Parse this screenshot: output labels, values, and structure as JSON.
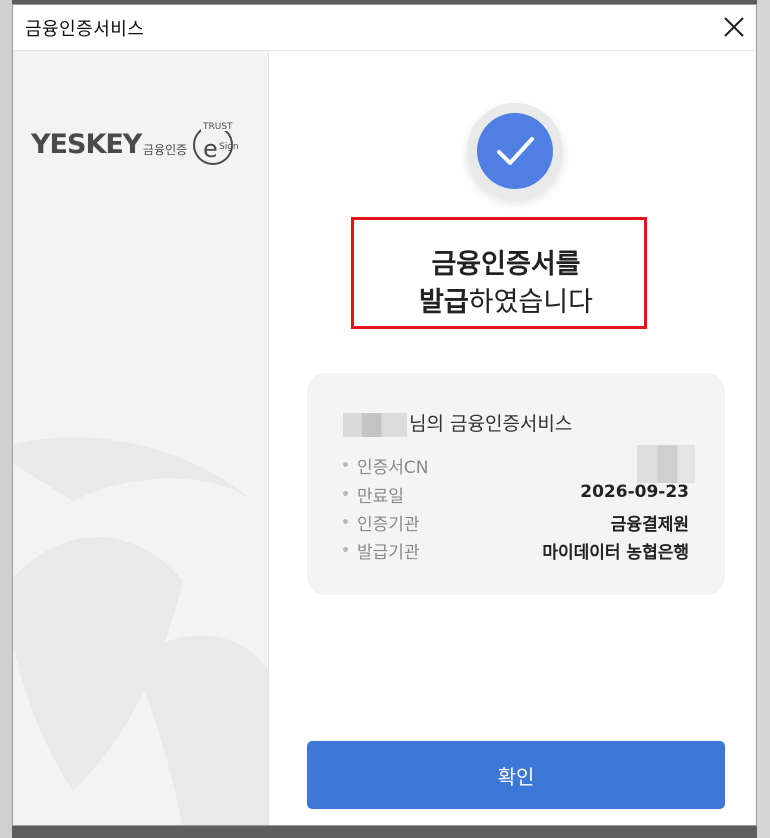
{
  "dialog": {
    "title": "금융인증서비스",
    "close_icon": "close-icon"
  },
  "brand": {
    "logo_text": "YESKEY",
    "logo_sub": "금융인증",
    "badge_icon": "trust-esign-icon"
  },
  "result": {
    "check_icon": "checkmark-icon",
    "line1": "금융인증서를",
    "line2_bold": "발급",
    "line2_rest": "하였습니다"
  },
  "card": {
    "title_suffix": "님의 금융인증서비스",
    "rows": [
      {
        "label": "인증서CN",
        "value": ""
      },
      {
        "label": "만료일",
        "value": "2026-09-23"
      },
      {
        "label": "인증기관",
        "value": "금융결제원"
      },
      {
        "label": "발급기관",
        "value": "마이데이터 농협은행"
      }
    ]
  },
  "confirm_label": "확인",
  "colors": {
    "accent": "#3d78d8",
    "check": "#4f7fe3",
    "highlight_border": "#e5141a"
  }
}
